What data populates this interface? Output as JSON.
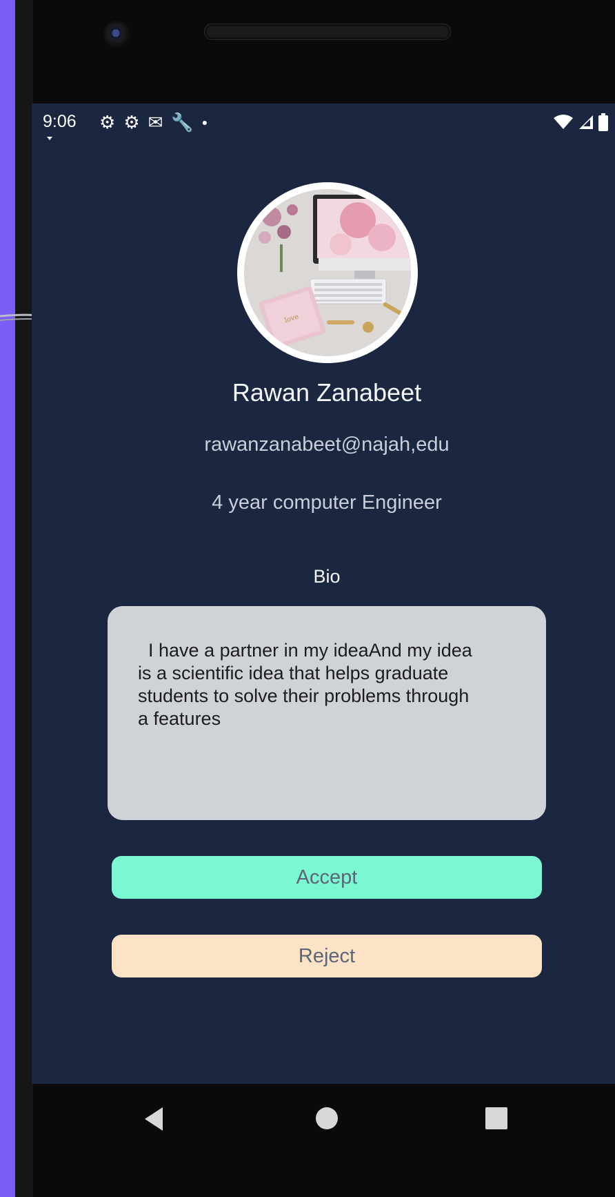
{
  "status_bar": {
    "time": "9:06",
    "icons": [
      "gear-icon",
      "gear-icon",
      "mail-icon",
      "wrench-icon",
      "dot-icon"
    ],
    "right_icons": [
      "wifi-icon",
      "signal-icon",
      "battery-icon"
    ]
  },
  "profile": {
    "name": "Rawan Zanabeet",
    "email": "rawanzanabeet@najah,edu",
    "major": "4 year computer Engineer",
    "bio_label": "Bio",
    "bio_text": "  I have a partner in my ideaAnd my idea\nis a scientific idea that helps graduate\nstudents to solve their problems through\na features"
  },
  "actions": {
    "accept_label": "Accept",
    "reject_label": "Reject"
  },
  "nav": {
    "icons": [
      "back-icon",
      "home-icon",
      "recents-icon"
    ]
  },
  "colors": {
    "screen_background": "#1b2641",
    "accept_button": "#7bf7d1",
    "reject_button": "#fde3c6",
    "bio_box": "#cfd2d6",
    "side_strip": "#7b5cf5"
  }
}
